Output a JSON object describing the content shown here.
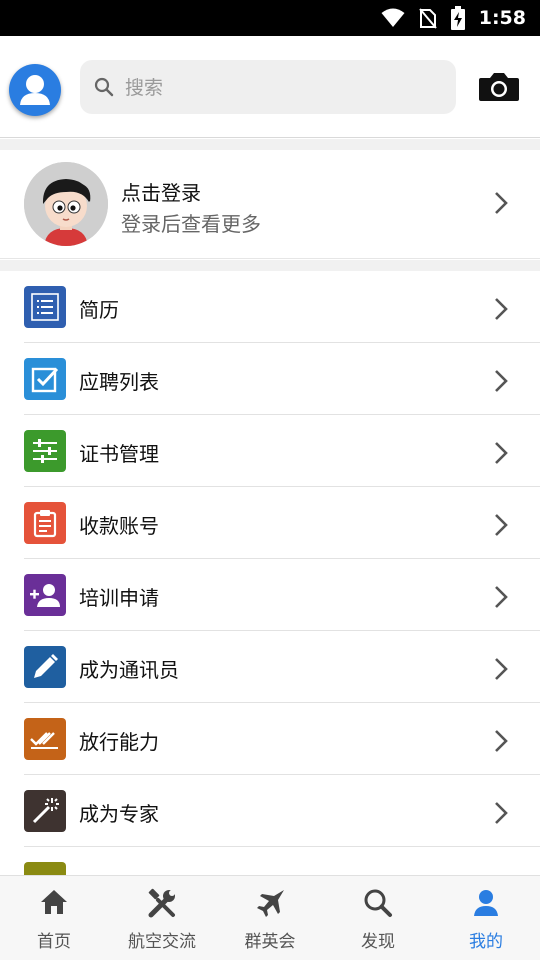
{
  "status_bar": {
    "time": "1:58",
    "icons": [
      "wifi-icon",
      "no-sim-icon",
      "battery-charging-icon"
    ]
  },
  "header": {
    "search_placeholder": "搜索",
    "left_icon": "user-avatar-icon",
    "right_icon": "camera-icon"
  },
  "login": {
    "title": "点击登录",
    "subtitle": "登录后查看更多"
  },
  "menu": [
    {
      "label": "简历",
      "icon": "list-icon",
      "color": "#2f5fb0"
    },
    {
      "label": "应聘列表",
      "icon": "checkbox-icon",
      "color": "#2a8fd8"
    },
    {
      "label": "证书管理",
      "icon": "sliders-icon",
      "color": "#3c9a2c"
    },
    {
      "label": "收款账号",
      "icon": "clipboard-icon",
      "color": "#e5533a"
    },
    {
      "label": "培训申请",
      "icon": "add-person-icon",
      "color": "#6a2f98"
    },
    {
      "label": "成为通讯员",
      "icon": "pencil-icon",
      "color": "#1f5fa0"
    },
    {
      "label": "放行能力",
      "icon": "double-check-icon",
      "color": "#c46318"
    },
    {
      "label": "成为专家",
      "icon": "magic-wand-icon",
      "color": "#3e3330"
    },
    {
      "label": "",
      "icon": "partial-icon",
      "color": "#8a8a12"
    }
  ],
  "bottom_nav": [
    {
      "label": "首页",
      "icon": "home-icon"
    },
    {
      "label": "航空交流",
      "icon": "tools-icon"
    },
    {
      "label": "群英会",
      "icon": "jet-icon"
    },
    {
      "label": "发现",
      "icon": "search-icon"
    },
    {
      "label": "我的",
      "icon": "person-icon",
      "active": true
    }
  ],
  "colors": {
    "accent": "#2a7de1",
    "nav_inactive": "#555555",
    "band": "#f1f1f1"
  }
}
